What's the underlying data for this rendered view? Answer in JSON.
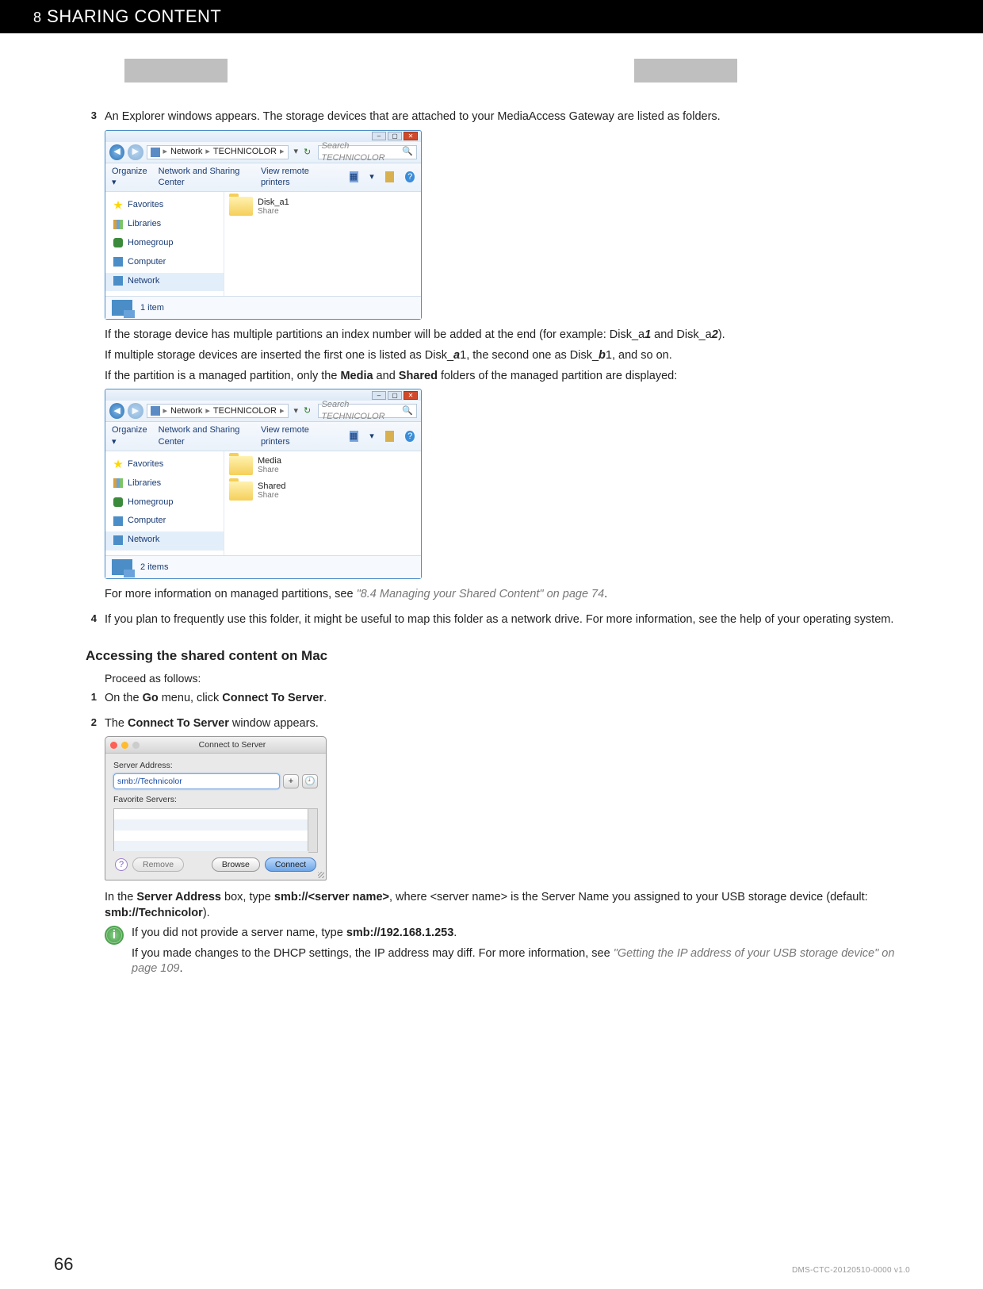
{
  "header": {
    "chapter_num": "8",
    "chapter_title": "SHARING CONTENT"
  },
  "steps_top": [
    {
      "num": "3",
      "lead": "An Explorer windows appears. The storage devices that are attached to your MediaAccess Gateway are listed as folders."
    }
  ],
  "explorer1": {
    "breadcrumb": [
      "Network",
      "TECHNICOLOR"
    ],
    "search_placeholder": "Search TECHNICOLOR",
    "toolbar": {
      "organize": "Organize",
      "sharing": "Network and Sharing Center",
      "view": "View remote printers"
    },
    "nav": {
      "favorites": "Favorites",
      "libraries": "Libraries",
      "homegroup": "Homegroup",
      "computer": "Computer",
      "network": "Network"
    },
    "items": [
      {
        "name": "Disk_a1",
        "sub": "Share"
      }
    ],
    "status": "1 item"
  },
  "para_partitions_pre": "If the storage device has multiple partitions an index number will be added at the end (for example: Disk_a",
  "para_partitions_b1": "1",
  "para_partitions_mid": " and Disk_a",
  "para_partitions_b2": "2",
  "para_partitions_end": ").",
  "para_multiple_pre": "If multiple storage devices are inserted the first one is listed as Disk_",
  "para_multiple_a": "a",
  "para_multiple_mid1": "1, the second one as Disk_",
  "para_multiple_b": "b",
  "para_multiple_end": "1, and so on.",
  "para_managed_pre": "If the partition is a managed partition, only the ",
  "para_managed_media": "Media",
  "para_managed_and": " and ",
  "para_managed_shared": "Shared",
  "para_managed_end": " folders of the managed partition are displayed:",
  "explorer2": {
    "breadcrumb": [
      "Network",
      "TECHNICOLOR"
    ],
    "search_placeholder": "Search TECHNICOLOR",
    "toolbar": {
      "organize": "Organize",
      "sharing": "Network and Sharing Center",
      "view": "View remote printers"
    },
    "nav": {
      "favorites": "Favorites",
      "libraries": "Libraries",
      "homegroup": "Homegroup",
      "computer": "Computer",
      "network": "Network"
    },
    "items": [
      {
        "name": "Media",
        "sub": "Share"
      },
      {
        "name": "Shared",
        "sub": "Share"
      }
    ],
    "status": "2 items"
  },
  "para_moreinfo_pre": "For more information on managed partitions, see ",
  "para_moreinfo_link": "\"8.4 Managing your Shared Content\" on page 74",
  "para_moreinfo_end": ".",
  "step4": {
    "num": "4",
    "text": "If you plan to frequently use this folder, it might be useful to map this folder as a network drive. For more information, see the help of your operating system."
  },
  "mac_head": "Accessing the shared content on Mac",
  "mac_proceed": "Proceed as follows:",
  "mac_step1": {
    "num": "1",
    "pre": "On the ",
    "b1": "Go",
    "mid": " menu, click ",
    "b2": "Connect To Server",
    "end": "."
  },
  "mac_step2": {
    "num": "2",
    "pre": "The ",
    "b1": "Connect To Server",
    "end": " window appears."
  },
  "macwin": {
    "title": "Connect to Server",
    "label_addr": "Server Address:",
    "addr_value": "smb://Technicolor",
    "plus": "+",
    "hist": "↻",
    "label_fav": "Favorite Servers:",
    "remove": "Remove",
    "browse": "Browse",
    "connect": "Connect"
  },
  "mac_inthe_pre": "In the ",
  "mac_inthe_b1": "Server Address",
  "mac_inthe_mid1": " box, type ",
  "mac_inthe_b2": "smb://<server name>",
  "mac_inthe_mid2": ", where <server name> is the Server Name you assigned to your USB storage device (default: ",
  "mac_inthe_b3": "smb://Technicolor",
  "mac_inthe_end": ").",
  "note1_pre": "If you did not provide a server name, type ",
  "note1_b": "smb://192.168.1.253",
  "note1_end": ".",
  "note2_pre": "If you made changes to the DHCP settings, the IP address may diff. For more information, see ",
  "note2_link": "\"Getting the IP address of your USB storage device\" on page 109",
  "note2_end": ".",
  "footer": {
    "page": "66",
    "docver": "DMS-CTC-20120510-0000 v1.0"
  }
}
